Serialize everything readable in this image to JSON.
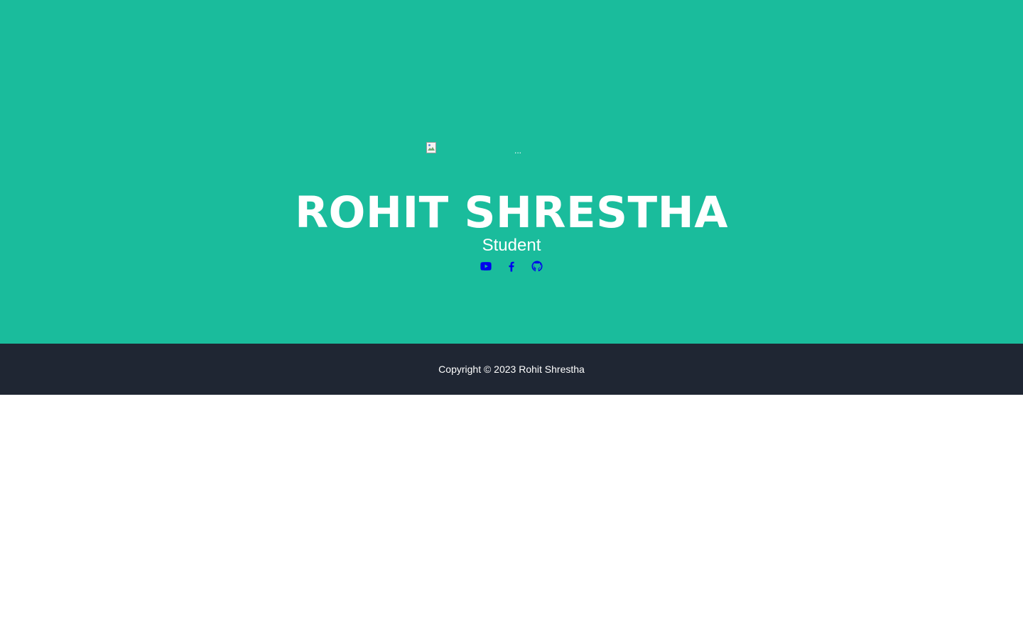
{
  "masthead": {
    "avatar": {
      "alt_text": "...",
      "broken_icon": "broken-image-icon"
    },
    "name": "ROHIT SHRESTHA",
    "role": "Student",
    "social_links": [
      {
        "icon": "youtube-icon"
      },
      {
        "icon": "facebook-icon"
      },
      {
        "icon": "github-icon"
      }
    ]
  },
  "footer": {
    "copyright": "Copyright © 2023 Rohit Shrestha"
  },
  "colors": {
    "masthead_background": "#1abc9c",
    "footer_background": "#1f2633",
    "heading_text": "#ffffff",
    "link": "#0000ee"
  }
}
